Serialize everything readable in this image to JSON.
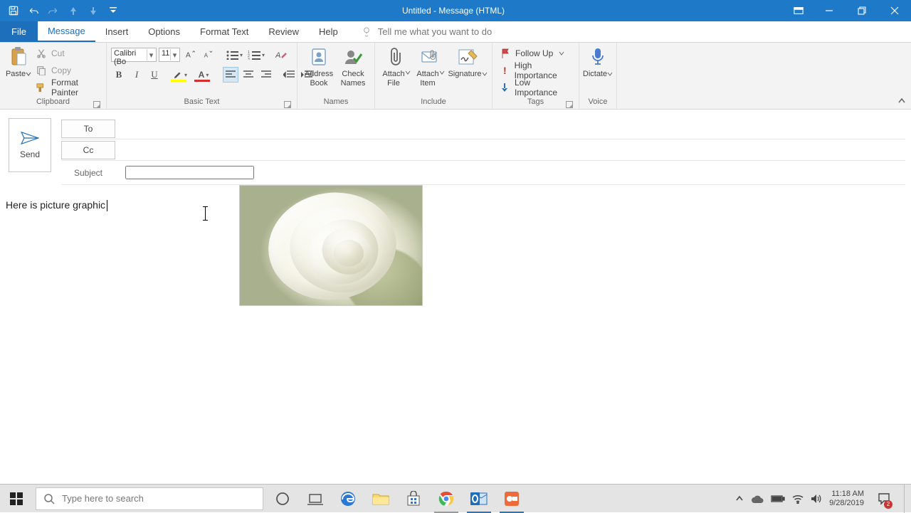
{
  "window": {
    "title": "Untitled  -  Message (HTML)"
  },
  "tabs": {
    "file": "File",
    "message": "Message",
    "insert": "Insert",
    "options": "Options",
    "format_text": "Format Text",
    "review": "Review",
    "help": "Help",
    "tellme_placeholder": "Tell me what you want to do"
  },
  "ribbon": {
    "clipboard": {
      "label": "Clipboard",
      "paste": "Paste",
      "cut": "Cut",
      "copy": "Copy",
      "format_painter": "Format Painter"
    },
    "basic_text": {
      "label": "Basic Text",
      "font_name": "Calibri (Bo",
      "font_size": "11"
    },
    "names": {
      "label": "Names",
      "address_book": "Address\nBook",
      "check_names": "Check\nNames"
    },
    "include": {
      "label": "Include",
      "attach_file": "Attach\nFile",
      "attach_item": "Attach\nItem",
      "signature": "Signature"
    },
    "tags": {
      "label": "Tags",
      "follow_up": "Follow Up",
      "high_importance": "High Importance",
      "low_importance": "Low Importance"
    },
    "voice": {
      "label": "Voice",
      "dictate": "Dictate"
    }
  },
  "compose": {
    "send": "Send",
    "to": "To",
    "cc": "Cc",
    "subject_label": "Subject",
    "to_value": "",
    "cc_value": "",
    "subject_value": ""
  },
  "body": {
    "text": "Here is picture graphic"
  },
  "taskbar": {
    "search_placeholder": "Type here to search",
    "time": "11:18 AM",
    "date": "9/28/2019",
    "notif_count": "2"
  }
}
